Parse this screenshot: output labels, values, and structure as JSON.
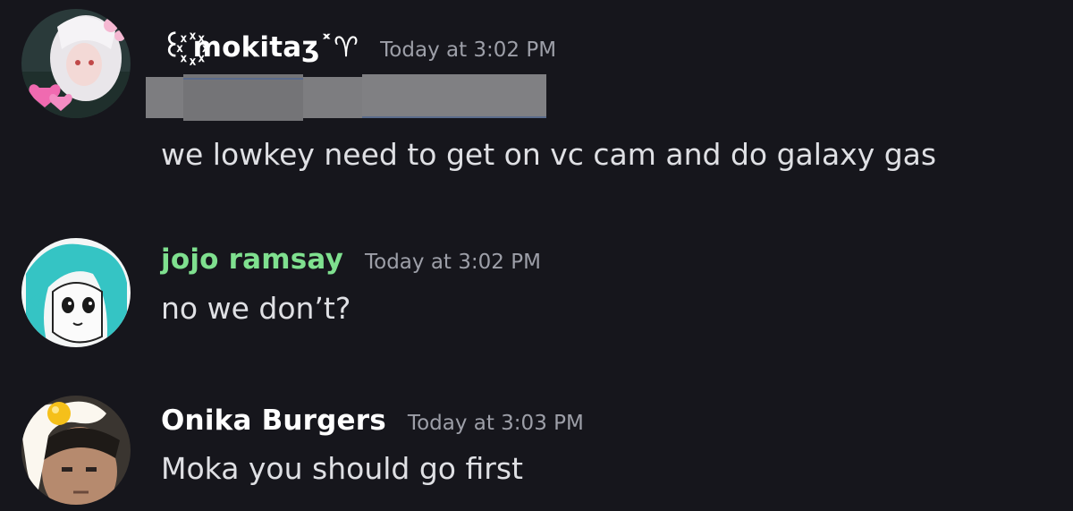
{
  "messages": [
    {
      "author": "꒰ ꙰mokitaʒ˟♈",
      "timestamp": "Today at 3:02 PM",
      "text": "we lowkey need to get on vc cam and do galaxy gas",
      "author_color": "#ffffff",
      "has_redacted_block": true
    },
    {
      "author": "jojo ramsay",
      "timestamp": "Today at 3:02 PM",
      "text": "no we don’t?",
      "author_color": "#7fe08f"
    },
    {
      "author": "Onika Burgers",
      "timestamp": "Today at 3:03 PM",
      "text": "Moka you should go first",
      "author_color": "#ffffff"
    }
  ],
  "colors": {
    "background": "#16161c",
    "timestamp": "#9d9fa8",
    "message_text": "#dfe0e4"
  }
}
